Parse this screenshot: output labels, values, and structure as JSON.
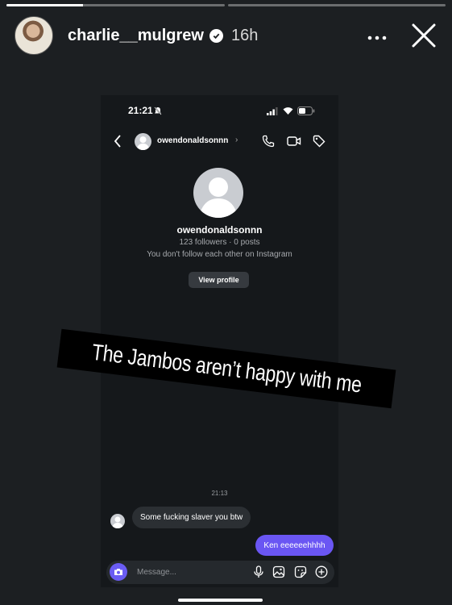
{
  "story": {
    "progress": [
      1,
      0
    ],
    "segment_progress": [
      0.35,
      0
    ],
    "username": "charlie__mulgrew",
    "time_ago": "16h",
    "more_icon": "more-horizontal-icon",
    "close_icon": "close-icon",
    "caption": "The Jambos aren’t happy with me"
  },
  "screenshot": {
    "status_bar": {
      "time": "21:21"
    },
    "dm_header": {
      "name": "owendonaldsonnn",
      "chevron": "›"
    },
    "profile": {
      "name": "owendonaldsonnn",
      "stats": "123 followers · 0 posts",
      "note": "You don't follow each other on Instagram",
      "view_profile_label": "View profile"
    },
    "messages": {
      "timestamp": "21:13",
      "incoming": "Some fucking slaver you btw",
      "outgoing": "Ken eeeeeehhhh"
    },
    "composer": {
      "placeholder": "Message..."
    }
  },
  "colors": {
    "background": "#1c1f22",
    "outgoing_bubble": "#6a56f3",
    "incoming_bubble": "#2b2f33",
    "camera_button": "#6a5cf3"
  }
}
